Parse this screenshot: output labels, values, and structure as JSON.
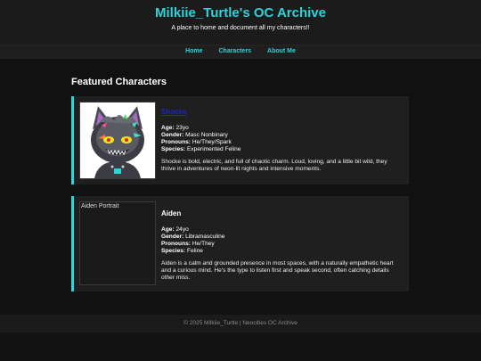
{
  "header": {
    "title": "Milkiie_Turtle's OC Archive",
    "tagline": "A place to home and document all my characters!!"
  },
  "nav": {
    "items": [
      {
        "label": "Home"
      },
      {
        "label": "Characters"
      },
      {
        "label": "About Me"
      }
    ]
  },
  "main": {
    "section_title": "Featured Characters",
    "characters": [
      {
        "name": "Shocke",
        "age_label": "Age:",
        "age": "23yo",
        "gender_label": "Gender:",
        "gender": "Masc Nonbinary",
        "pronouns_label": "Pronouns:",
        "pronouns": "He/They/Spark",
        "species_label": "Species:",
        "species": "Experimented Feline",
        "description": "Shocke is bold, electric, and full of chaotic charm. Loud, loving, and a little bit wild, they thrive in adventures of neon-lit nights and intensive moments."
      },
      {
        "name": "Aiden",
        "portrait_alt": "Aiden Portrait",
        "age_label": "Age:",
        "age": "24yo",
        "gender_label": "Gender:",
        "gender": "Libramasculine",
        "pronouns_label": "Pronouns:",
        "pronouns": "He/They",
        "species_label": "Species:",
        "species": "Feline",
        "description": "Aiden is a calm and grounded presence in most spaces, with a naturally empathetic heart and a curious mind. He's the type to listen first and speak second, often catching details other miss."
      }
    ]
  },
  "footer": {
    "text": "© 2025 Milkiie_Turtle | Neocities OC Archive"
  },
  "colors": {
    "accent": "#2ad4d9",
    "background": "#111111",
    "card": "#1f1f1f",
    "link": "#1d24c8"
  }
}
